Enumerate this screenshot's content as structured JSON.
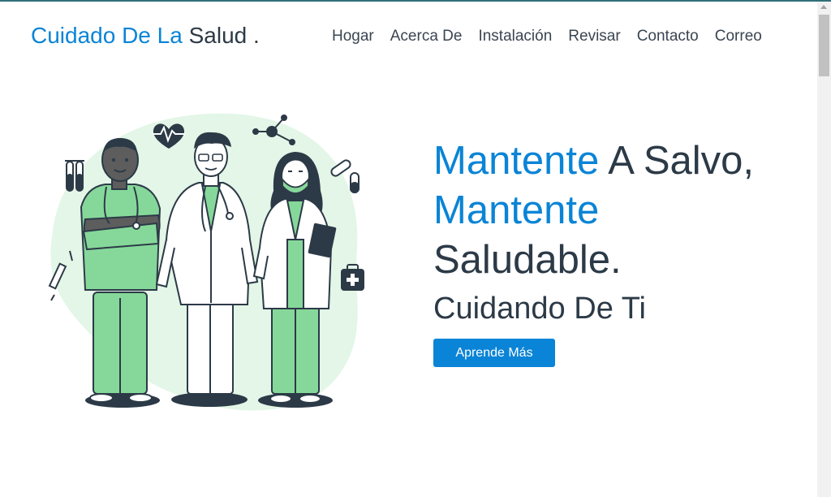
{
  "header": {
    "logo_blue": "Cuidado De La",
    "logo_dark": "Salud .",
    "nav": [
      "Hogar",
      "Acerca De",
      "Instalación",
      "Revisar",
      "Contacto",
      "Correo"
    ]
  },
  "hero": {
    "line1_blue": "Mantente",
    "line1_dark": "A Salvo,",
    "line2_blue": "Mantente",
    "line3_dark": "Saludable.",
    "subhead": "Cuidando De Ti",
    "cta": "Aprende Más"
  },
  "colors": {
    "accent": "#0a84d6",
    "text_dark": "#2c3a47",
    "scrub_green": "#86d89a",
    "blob": "#e3f6e7"
  },
  "icons": [
    "heart-rate-icon",
    "molecule-icon",
    "test-tubes-icon",
    "pills-icon",
    "syringe-icon",
    "first-aid-kit-icon"
  ]
}
